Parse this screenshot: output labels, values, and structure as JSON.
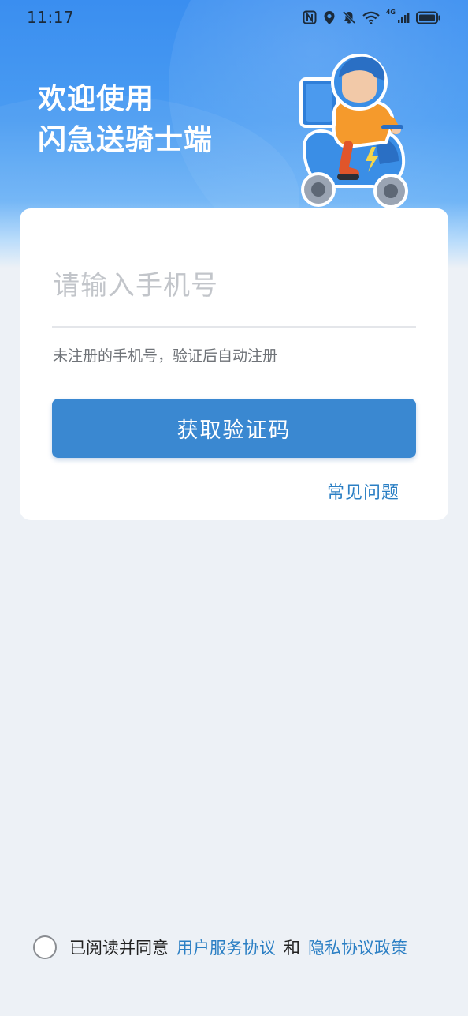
{
  "status_bar": {
    "time": "11:17",
    "icons": [
      "nfc-icon",
      "location-icon",
      "mute-bell-icon",
      "wifi-icon",
      "signal-icon",
      "battery-icon"
    ],
    "network_label": "4G"
  },
  "header": {
    "title_line1": "欢迎使用",
    "title_line2": "闪急送骑士端"
  },
  "login": {
    "phone_placeholder": "请输入手机号",
    "phone_value": "",
    "hint": "未注册的手机号，验证后自动注册",
    "get_code_label": "获取验证码",
    "faq_label": "常见问题"
  },
  "agreement": {
    "checked": false,
    "prefix": "已阅读并同意",
    "user_agreement": "用户服务协议",
    "and": "和",
    "privacy_policy": "隐私协议政策"
  },
  "colors": {
    "primary": "#3a88d1",
    "link": "#2b7fc4",
    "header_blue": "#3a8ef0",
    "page_bg": "#edf1f6"
  }
}
